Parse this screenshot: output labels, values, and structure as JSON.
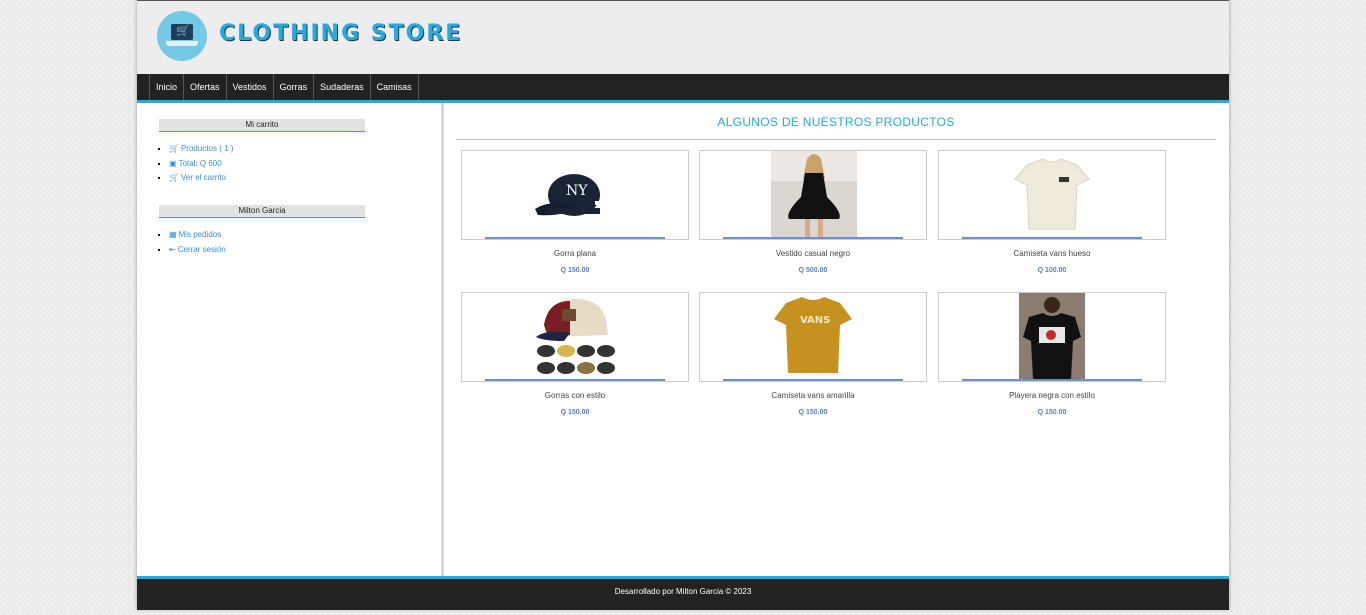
{
  "header": {
    "title": "CLOTHING STORE",
    "logo_icon": "laptop-cart-icon"
  },
  "nav": {
    "items": [
      "Inicio",
      "Ofertas",
      "Vestidos",
      "Gorras",
      "Sudaderas",
      "Camisas"
    ]
  },
  "sidebar": {
    "cart": {
      "title": "Mi carrito",
      "items": [
        {
          "icon": "cart-icon",
          "label": "Productos ( 1 )"
        },
        {
          "icon": "money-icon",
          "label": "Total: Q 600"
        },
        {
          "icon": "cart-icon",
          "label": "Ver el carrito"
        }
      ]
    },
    "user": {
      "title": "Milton Garcia",
      "items": [
        {
          "icon": "clipboard-icon",
          "label": "Mis pedidos"
        },
        {
          "icon": "logout-icon",
          "label": "Cerrar sesión"
        }
      ]
    }
  },
  "main": {
    "title": "ALGUNOS DE NUESTROS PRODUCTOS",
    "products": [
      {
        "name": "Gorra plana",
        "price": "Q 150.00"
      },
      {
        "name": "Vestido casual negro",
        "price": "Q 500.00"
      },
      {
        "name": "Camiseta vans hueso",
        "price": "Q 100.00"
      },
      {
        "name": "Gorras con estilo",
        "price": "Q 150.00"
      },
      {
        "name": "Camiseta vans amarilla",
        "price": "Q 150.00"
      },
      {
        "name": "Playera negra con estilo",
        "price": "Q 150.00"
      }
    ]
  },
  "footer": {
    "text": "Desarrollado por Milton Garcia © 2023"
  },
  "colors": {
    "accent": "#29a8dc",
    "nav_bg": "#222222",
    "link": "#3b8fd0",
    "price": "#5b7ec0"
  }
}
